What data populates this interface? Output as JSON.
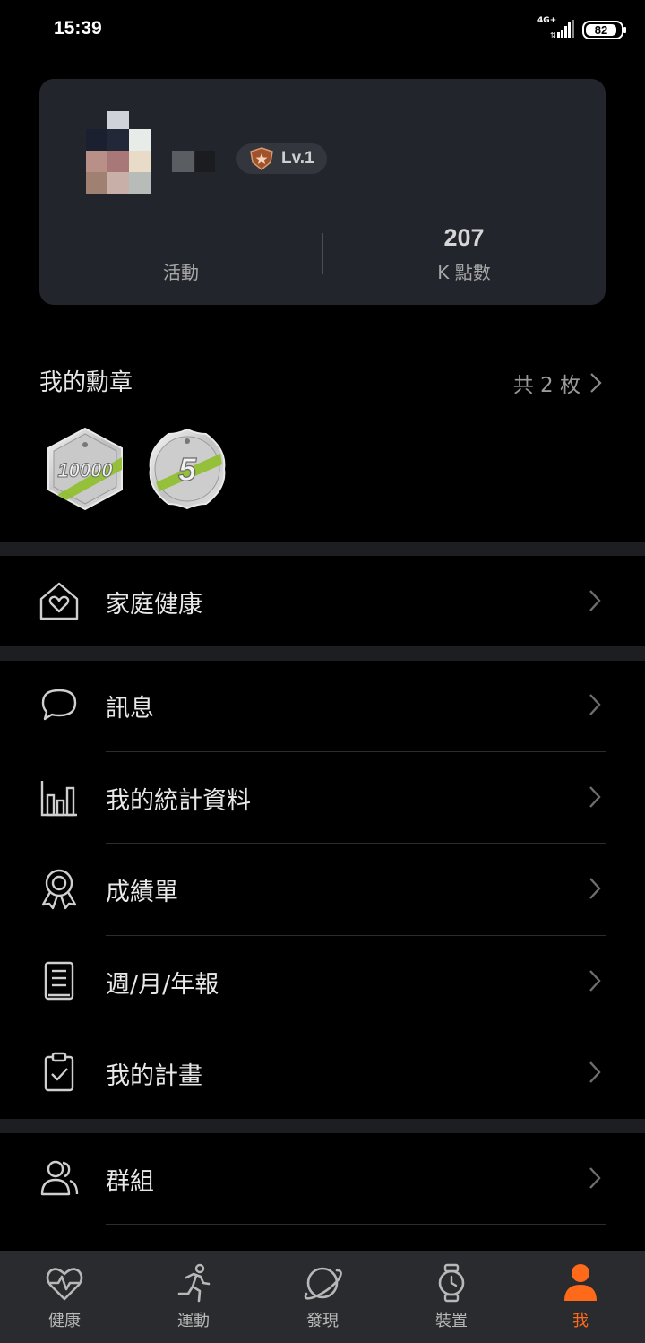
{
  "status_bar": {
    "time": "15:39",
    "network": "4G+",
    "battery": "82"
  },
  "profile": {
    "level": "Lv.1",
    "stats": [
      {
        "value": "",
        "label": "活動"
      },
      {
        "value": "207",
        "label": "K 點數"
      }
    ]
  },
  "medals": {
    "title": "我的勳章",
    "count": "共 2 枚",
    "items": [
      {
        "icon": "medal-10000-steps",
        "text": "10000"
      },
      {
        "icon": "medal-5km-cycling",
        "text": "5"
      }
    ]
  },
  "menu": {
    "family_health": "家庭健康",
    "messages": "訊息",
    "statistics": "我的統計資料",
    "transcript": "成績單",
    "reports": "週/月/年報",
    "plans": "我的計畫",
    "groups": "群組"
  },
  "tabs": [
    {
      "label": "健康",
      "icon": "heart-pulse-icon"
    },
    {
      "label": "運動",
      "icon": "running-icon"
    },
    {
      "label": "發現",
      "icon": "planet-icon"
    },
    {
      "label": "裝置",
      "icon": "watch-icon"
    },
    {
      "label": "我",
      "icon": "person-icon",
      "active": true
    }
  ],
  "colors": {
    "accent": "#ff6a1a",
    "card": "#22252c",
    "background": "#000000"
  }
}
